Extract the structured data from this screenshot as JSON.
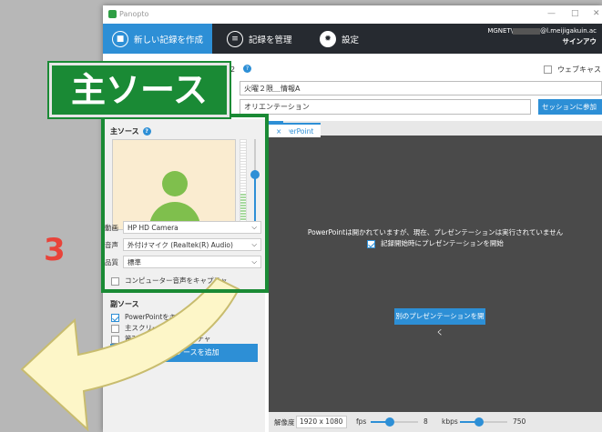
{
  "app": {
    "name": "Panopto"
  },
  "nav": {
    "create": "新しい記録を作成",
    "manage": "記録を管理",
    "settings": "設定"
  },
  "account": {
    "user_prefix": "MGNET\\",
    "user_suffix": "@l.meijigakuin.ac",
    "signout": "サインアウ"
  },
  "session": {
    "title_partial": "2",
    "webcast_label": "ウェブキャス",
    "folder_value": "火曜２限＿情報A",
    "name_value": "オリエンテーション",
    "join_button": "セッションに参加"
  },
  "primary": {
    "title": "主ソース",
    "help": "?",
    "video_label": "動画",
    "video_value": "HP HD Camera",
    "audio_label": "音声",
    "audio_value": "外付けマイク (Realtek(R) Audio)",
    "quality_label": "品質",
    "quality_value": "標準",
    "capture_audio": "コンピューター音声をキャプチャ",
    "audio_level": 0.4,
    "volume_level": 0.6
  },
  "secondary": {
    "title": "副ソース",
    "items": [
      {
        "label": "PowerPointをキャプチャ",
        "checked": true
      },
      {
        "label": "主スクリーンをキャプチャ",
        "checked": false
      },
      {
        "label": "第2スクリーンをキャプチャ",
        "checked": false
      }
    ],
    "add_button": "別の動画ソースを追加"
  },
  "preview": {
    "tab": "PowerPoint",
    "tab_close": "×",
    "message": "PowerPointは開かれていますが、現在、プレゼンテーションは実行されていません",
    "auto_start": "記録開始時にプレゼンテーションを開始",
    "open_button": "別のプレゼンテーションを開く"
  },
  "bottom": {
    "resolution_label": "解像度",
    "resolution_value": "1920 x 1080",
    "fps_label": "fps",
    "fps_value": "8",
    "kbps_label": "kbps",
    "kbps_value": "750"
  },
  "annotation": {
    "callout": "主ソース",
    "step": "3",
    "color": "#1a8a35",
    "step_color": "#e8433a",
    "arrow_color": "#fdf6c8"
  }
}
